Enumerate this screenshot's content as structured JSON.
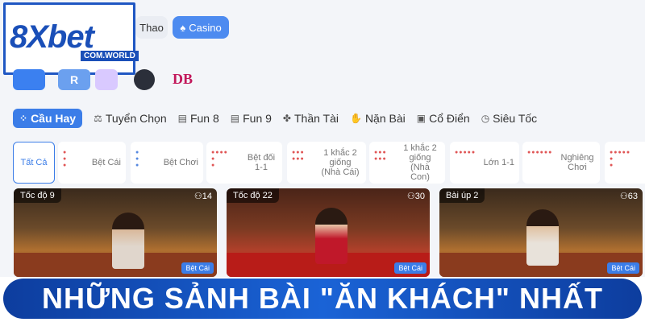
{
  "logo": {
    "text": "8Xbet",
    "domain": "COM.WORLD"
  },
  "top_tabs": {
    "thao": "Thao",
    "casino": "Casino"
  },
  "provider_icons": {
    "p2_text": "R",
    "p5_text": "DB"
  },
  "categories": [
    {
      "label": "Cầu Hay",
      "icon": "grid-icon"
    },
    {
      "label": "Tuyển Chọn",
      "icon": "scale-icon"
    },
    {
      "label": "Fun 8",
      "icon": "card-icon"
    },
    {
      "label": "Fun 9",
      "icon": "card-icon"
    },
    {
      "label": "Thần Tài",
      "icon": "clover-icon"
    },
    {
      "label": "Nặn Bài",
      "icon": "hand-icon"
    },
    {
      "label": "Cổ Điển",
      "icon": "cards-icon"
    },
    {
      "label": "Siêu Tốc",
      "icon": "clock-icon"
    }
  ],
  "filters": [
    {
      "label": "Tất Cả"
    },
    {
      "label": "Bệt Cái"
    },
    {
      "label": "Bệt Chơi"
    },
    {
      "label": "Bệt đối 1-1"
    },
    {
      "label": "1 khắc 2 giống (Nhà Cái)"
    },
    {
      "label": "1 khắc 2 giống (Nhà Con)"
    },
    {
      "label": "Lớn 1-1"
    },
    {
      "label": "Nghiêng Chơi"
    }
  ],
  "cards": [
    {
      "tag": "Tốc độ 9",
      "count": "14",
      "badge": "Bệt Cái"
    },
    {
      "tag": "Tốc độ 22",
      "count": "30",
      "badge": "Bệt Cái"
    },
    {
      "tag": "Bài úp 2",
      "count": "63",
      "badge": "Bệt Cái"
    }
  ],
  "banner": {
    "text": "NHỮNG SẢNH BÀI \"ĂN KHÁCH\" NHẤT"
  },
  "colors": {
    "accent": "#3b7de8",
    "brand_blue": "#1a4fb8",
    "banner": "#1a63d6"
  }
}
